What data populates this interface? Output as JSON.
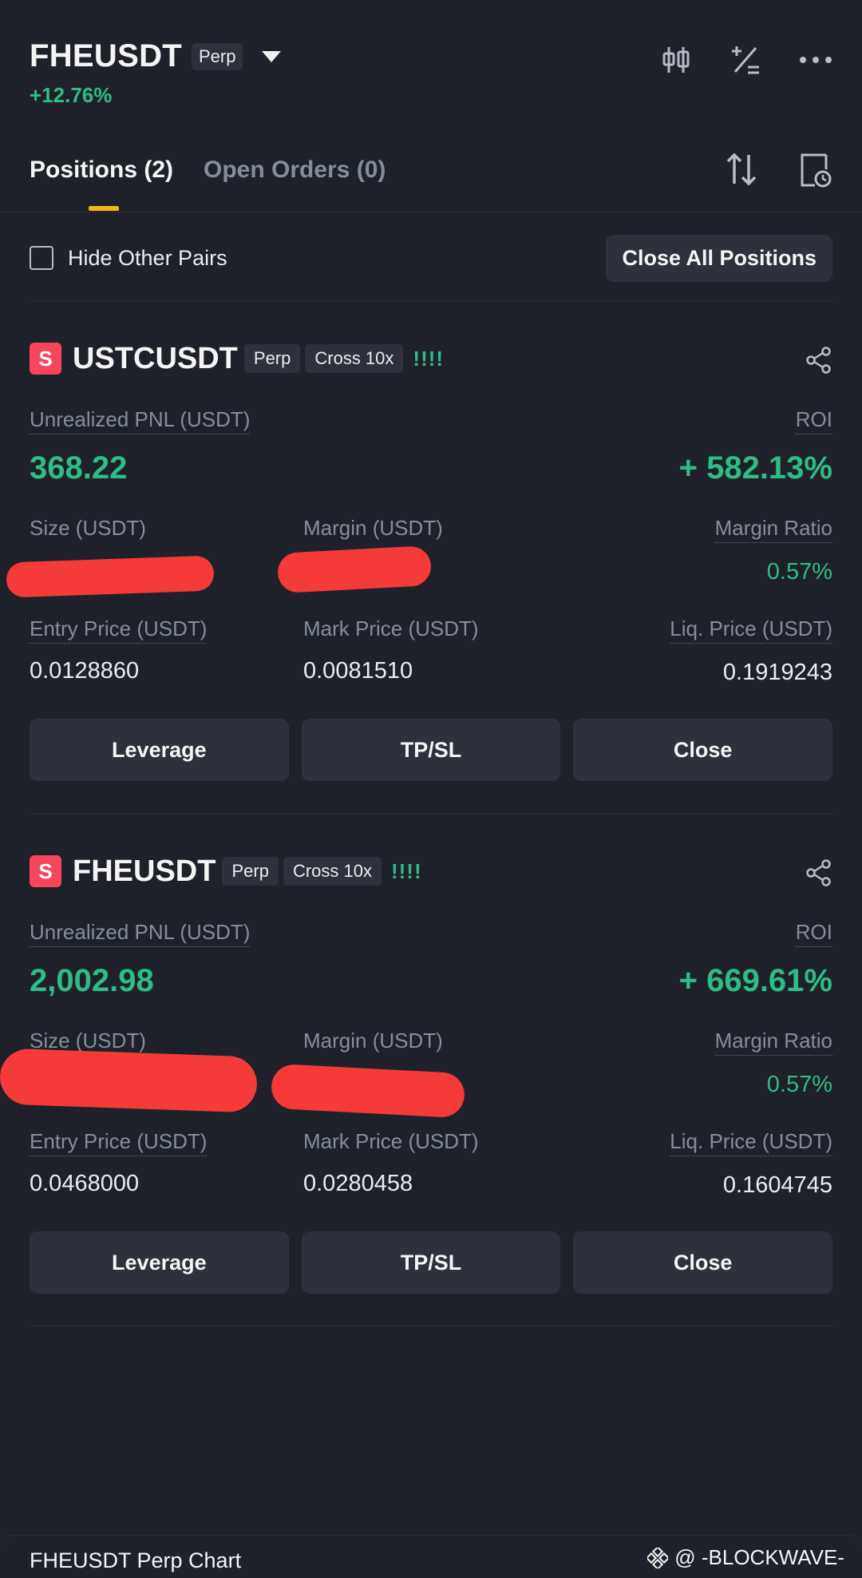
{
  "header": {
    "symbol": "FHEUSDT",
    "contract_tag": "Perp",
    "change": "+12.76%"
  },
  "tabs": [
    {
      "label": "Positions (2)",
      "active": true
    },
    {
      "label": "Open Orders (0)",
      "active": false
    }
  ],
  "filter": {
    "hide_other_pairs_label": "Hide Other Pairs",
    "hide_other_pairs_checked": false,
    "close_all_label": "Close All Positions"
  },
  "labels": {
    "unrealized_pnl": "Unrealized PNL (USDT)",
    "roi": "ROI",
    "size": "Size (USDT)",
    "margin": "Margin (USDT)",
    "margin_ratio": "Margin Ratio",
    "entry_price": "Entry Price (USDT)",
    "mark_price": "Mark Price (USDT)",
    "liq_price": "Liq. Price (USDT)",
    "btn_leverage": "Leverage",
    "btn_tpsl": "TP/SL",
    "btn_close": "Close"
  },
  "positions": [
    {
      "side_badge": "S",
      "symbol": "USTCUSDT",
      "contract_tag": "Perp",
      "margin_mode": "Cross 10x",
      "risk_bars": "!!!!",
      "unrealized_pnl": "368.22",
      "roi": "+ 582.13%",
      "margin_ratio": "0.57%",
      "entry_price": "0.0128860",
      "mark_price": "0.0081510",
      "liq_price": "0.1919243"
    },
    {
      "side_badge": "S",
      "symbol": "FHEUSDT",
      "contract_tag": "Perp",
      "margin_mode": "Cross 10x",
      "risk_bars": "!!!!",
      "unrealized_pnl": "2,002.98",
      "roi": "+ 669.61%",
      "margin_ratio": "0.57%",
      "entry_price": "0.0468000",
      "mark_price": "0.0280458",
      "liq_price": "0.1604745"
    }
  ],
  "bottom": {
    "chart_title": "FHEUSDT Perp Chart",
    "watermark": "@ -BLOCKWAVE-"
  },
  "colors": {
    "background": "#1e2129",
    "positive": "#2ebd85",
    "short_badge": "#f6465d",
    "tab_indicator": "#f0b90b",
    "redaction": "#f53a3a"
  }
}
